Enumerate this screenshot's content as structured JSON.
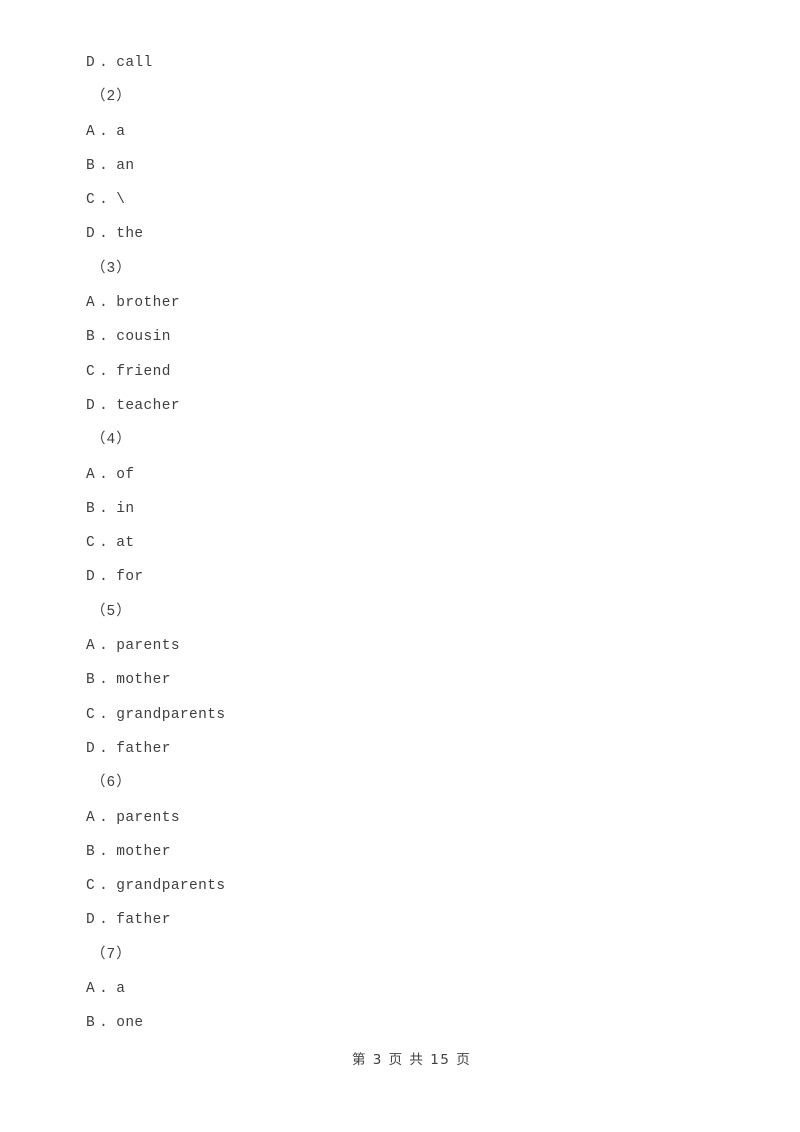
{
  "page": {
    "background_color": "#ffffff",
    "text_color": "#3f3f3f"
  },
  "footer": {
    "text": "第 3 页 共 15 页",
    "current_page": 3,
    "total_pages": 15
  },
  "blocks": [
    {
      "kind": "option",
      "letter": "D",
      "sep": ".",
      "text": "call"
    },
    {
      "kind": "qnum",
      "text": "（2）"
    },
    {
      "kind": "option",
      "letter": "A",
      "sep": ".",
      "text": "a"
    },
    {
      "kind": "option",
      "letter": "B",
      "sep": ".",
      "text": "an"
    },
    {
      "kind": "option",
      "letter": "C",
      "sep": ".",
      "text": "\\"
    },
    {
      "kind": "option",
      "letter": "D",
      "sep": ".",
      "text": "the"
    },
    {
      "kind": "qnum",
      "text": "（3）"
    },
    {
      "kind": "option",
      "letter": "A",
      "sep": ".",
      "text": "brother"
    },
    {
      "kind": "option",
      "letter": "B",
      "sep": ".",
      "text": "cousin"
    },
    {
      "kind": "option",
      "letter": "C",
      "sep": ".",
      "text": "friend"
    },
    {
      "kind": "option",
      "letter": "D",
      "sep": ".",
      "text": "teacher"
    },
    {
      "kind": "qnum",
      "text": "（4）"
    },
    {
      "kind": "option",
      "letter": "A",
      "sep": ".",
      "text": "of"
    },
    {
      "kind": "option",
      "letter": "B",
      "sep": ".",
      "text": "in"
    },
    {
      "kind": "option",
      "letter": "C",
      "sep": ".",
      "text": "at"
    },
    {
      "kind": "option",
      "letter": "D",
      "sep": ".",
      "text": "for"
    },
    {
      "kind": "qnum",
      "text": "（5）"
    },
    {
      "kind": "option",
      "letter": "A",
      "sep": ".",
      "text": "parents"
    },
    {
      "kind": "option",
      "letter": "B",
      "sep": ".",
      "text": "mother"
    },
    {
      "kind": "option",
      "letter": "C",
      "sep": ".",
      "text": "grandparents"
    },
    {
      "kind": "option",
      "letter": "D",
      "sep": ".",
      "text": "father"
    },
    {
      "kind": "qnum",
      "text": "（6）"
    },
    {
      "kind": "option",
      "letter": "A",
      "sep": ".",
      "text": "parents"
    },
    {
      "kind": "option",
      "letter": "B",
      "sep": ".",
      "text": "mother"
    },
    {
      "kind": "option",
      "letter": "C",
      "sep": ".",
      "text": "grandparents"
    },
    {
      "kind": "option",
      "letter": "D",
      "sep": ".",
      "text": "father"
    },
    {
      "kind": "qnum",
      "text": "（7）"
    },
    {
      "kind": "option",
      "letter": "A",
      "sep": ".",
      "text": "a"
    },
    {
      "kind": "option",
      "letter": "B",
      "sep": ".",
      "text": "one"
    }
  ]
}
